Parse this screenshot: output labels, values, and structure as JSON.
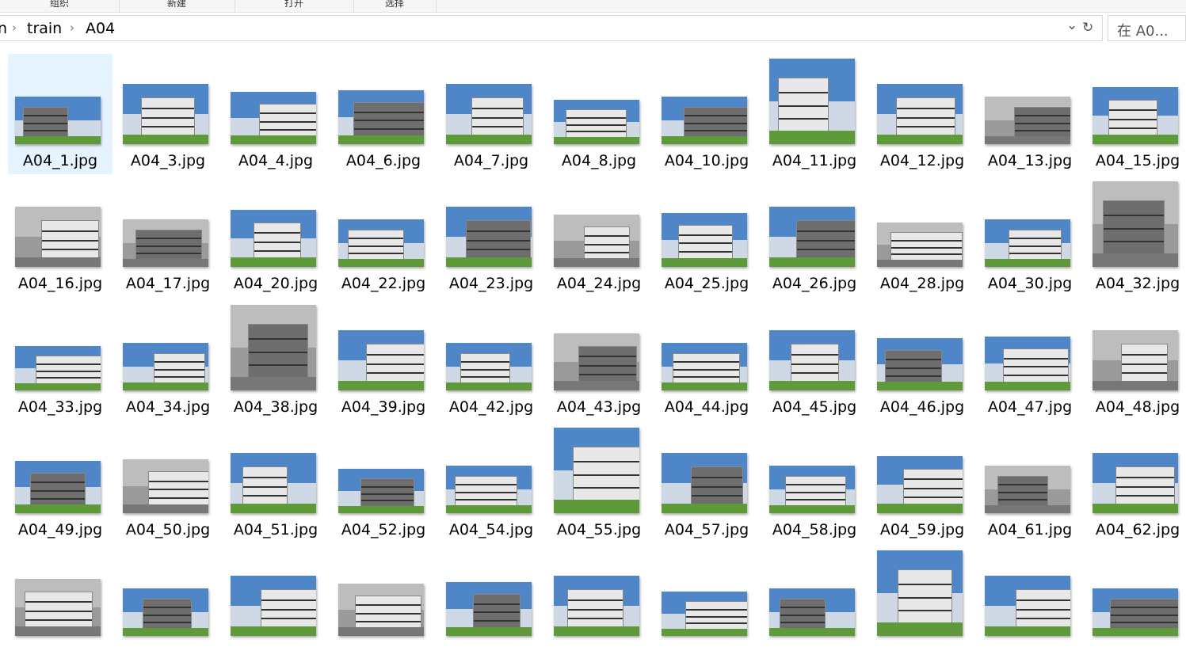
{
  "ribbon": {
    "groups": [
      {
        "label": "组织"
      },
      {
        "label": "新建"
      },
      {
        "label": "打开"
      },
      {
        "label": "选择"
      }
    ]
  },
  "address": {
    "partial": "n",
    "crumbs": [
      "train",
      "A04"
    ],
    "separator": "›",
    "dropdown_glyph": "⌄",
    "refresh_glyph": "↻"
  },
  "search": {
    "placeholder": "在 A0..."
  },
  "files": [
    {
      "name": "A04_1.jpg",
      "t": "color",
      "selected": true
    },
    {
      "name": "A04_3.jpg",
      "t": "color"
    },
    {
      "name": "A04_4.jpg",
      "t": "color"
    },
    {
      "name": "A04_6.jpg",
      "t": "color"
    },
    {
      "name": "A04_7.jpg",
      "t": "color"
    },
    {
      "name": "A04_8.jpg",
      "t": "color"
    },
    {
      "name": "A04_10.jpg",
      "t": "color"
    },
    {
      "name": "A04_11.jpg",
      "t": "color"
    },
    {
      "name": "A04_12.jpg",
      "t": "color"
    },
    {
      "name": "A04_13.jpg",
      "t": "bw"
    },
    {
      "name": "A04_15.jpg",
      "t": "color"
    },
    {
      "name": "A04_16.jpg",
      "t": "bw"
    },
    {
      "name": "A04_17.jpg",
      "t": "bw"
    },
    {
      "name": "A04_20.jpg",
      "t": "color"
    },
    {
      "name": "A04_22.jpg",
      "t": "color"
    },
    {
      "name": "A04_23.jpg",
      "t": "color"
    },
    {
      "name": "A04_24.jpg",
      "t": "bw"
    },
    {
      "name": "A04_25.jpg",
      "t": "color"
    },
    {
      "name": "A04_26.jpg",
      "t": "color"
    },
    {
      "name": "A04_28.jpg",
      "t": "bw"
    },
    {
      "name": "A04_30.jpg",
      "t": "color"
    },
    {
      "name": "A04_32.jpg",
      "t": "bw"
    },
    {
      "name": "A04_33.jpg",
      "t": "color"
    },
    {
      "name": "A04_34.jpg",
      "t": "color"
    },
    {
      "name": "A04_38.jpg",
      "t": "bw"
    },
    {
      "name": "A04_39.jpg",
      "t": "color"
    },
    {
      "name": "A04_42.jpg",
      "t": "color"
    },
    {
      "name": "A04_43.jpg",
      "t": "bw"
    },
    {
      "name": "A04_44.jpg",
      "t": "color"
    },
    {
      "name": "A04_45.jpg",
      "t": "color"
    },
    {
      "name": "A04_46.jpg",
      "t": "color"
    },
    {
      "name": "A04_47.jpg",
      "t": "color"
    },
    {
      "name": "A04_48.jpg",
      "t": "bw"
    },
    {
      "name": "A04_49.jpg",
      "t": "color"
    },
    {
      "name": "A04_50.jpg",
      "t": "bw"
    },
    {
      "name": "A04_51.jpg",
      "t": "color"
    },
    {
      "name": "A04_52.jpg",
      "t": "color"
    },
    {
      "name": "A04_54.jpg",
      "t": "color"
    },
    {
      "name": "A04_55.jpg",
      "t": "color"
    },
    {
      "name": "A04_57.jpg",
      "t": "color"
    },
    {
      "name": "A04_58.jpg",
      "t": "color"
    },
    {
      "name": "A04_59.jpg",
      "t": "color"
    },
    {
      "name": "A04_61.jpg",
      "t": "bw"
    },
    {
      "name": "A04_62.jpg",
      "t": "color"
    },
    {
      "name": "",
      "t": "bw"
    },
    {
      "name": "",
      "t": "color"
    },
    {
      "name": "",
      "t": "color"
    },
    {
      "name": "",
      "t": "bw"
    },
    {
      "name": "",
      "t": "color"
    },
    {
      "name": "",
      "t": "color"
    },
    {
      "name": "",
      "t": "color"
    },
    {
      "name": "",
      "t": "color"
    },
    {
      "name": "",
      "t": "color"
    },
    {
      "name": "",
      "t": "color"
    },
    {
      "name": "",
      "t": "color"
    }
  ],
  "colors": {
    "selection": "#e5f3ff",
    "sky": "#4f86c8",
    "sky_bw": "#bdbdbd",
    "building": "#e8e8e8",
    "building_dark": "#6e6e6e",
    "grass": "#5f9a3a",
    "window": "#333333"
  }
}
